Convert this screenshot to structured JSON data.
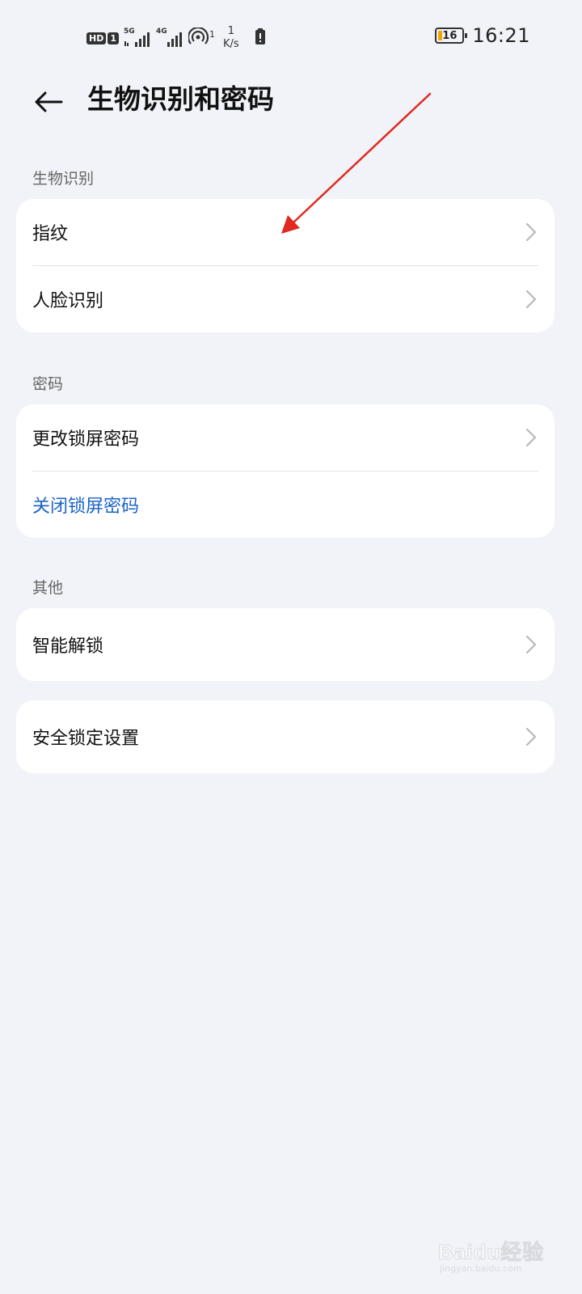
{
  "status_bar": {
    "hd_label": "HD",
    "sim_label": "1",
    "network_1": "5G",
    "network_2": "4G",
    "hotspot_count": "1",
    "speed_value": "1",
    "speed_unit": "K/s",
    "battery_level": "16",
    "time": "16:21"
  },
  "app_bar": {
    "back_icon": "arrow-left-icon",
    "title": "生物识别和密码"
  },
  "sections": {
    "biometrics": {
      "header": "生物识别",
      "items": [
        {
          "label": "指纹"
        },
        {
          "label": "人脸识别"
        }
      ]
    },
    "password": {
      "header": "密码",
      "items": [
        {
          "label": "更改锁屏密码"
        },
        {
          "label": "关闭锁屏密码"
        }
      ]
    },
    "other": {
      "header": "其他",
      "items": [
        {
          "label": "智能解锁"
        }
      ]
    },
    "security_lock": {
      "items": [
        {
          "label": "安全锁定设置"
        }
      ]
    }
  },
  "colors": {
    "background": "#f1f3f8",
    "card": "#ffffff",
    "link_blue": "#1a63c9",
    "annotation_red": "#e02a21",
    "battery_low": "#f2a400"
  },
  "watermark": {
    "brand": "Baidu经验",
    "url": "jingyan.baidu.com"
  }
}
